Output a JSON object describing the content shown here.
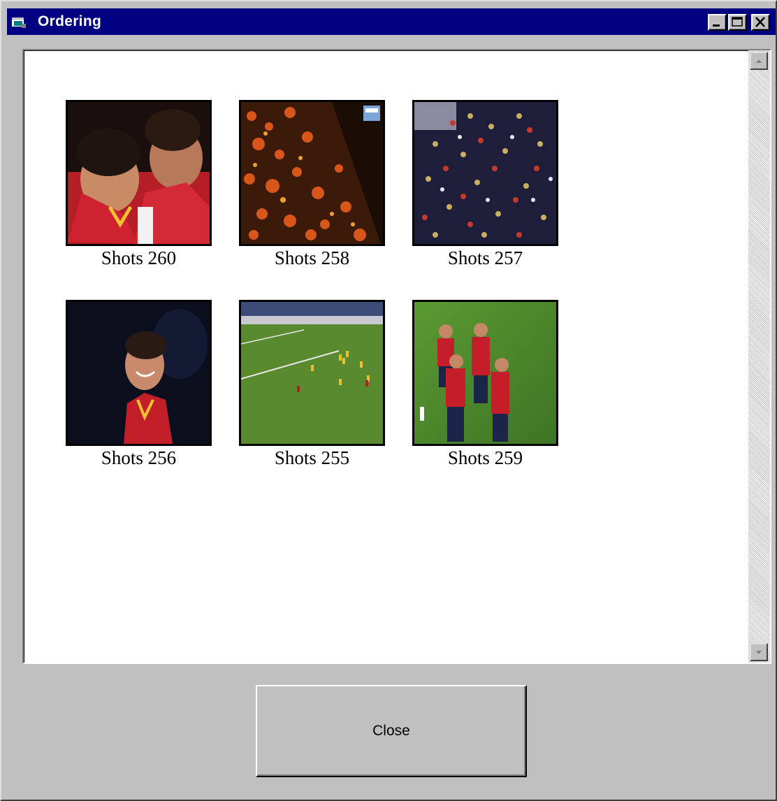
{
  "window": {
    "title": "Ordering",
    "app_icon": "app-window-icon",
    "controls": [
      "minimize-icon",
      "maximize-icon",
      "close-icon"
    ]
  },
  "shots": [
    {
      "label": "Shots 260",
      "scene": "players-closeup"
    },
    {
      "label": "Shots 258",
      "scene": "crowd-flares"
    },
    {
      "label": "Shots 257",
      "scene": "crowd-stands"
    },
    {
      "label": "Shots 256",
      "scene": "player-smiling"
    },
    {
      "label": "Shots 255",
      "scene": "pitch-wide"
    },
    {
      "label": "Shots 259",
      "scene": "players-celebrating"
    }
  ],
  "scrollbar": {
    "up_icon": "arrow-up-icon",
    "down_icon": "arrow-down-icon"
  },
  "footer": {
    "close_label": "Close"
  }
}
